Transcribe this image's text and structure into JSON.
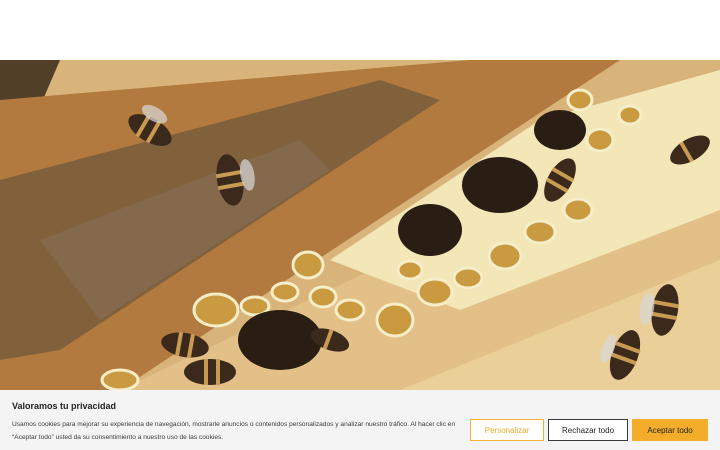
{
  "hero": {
    "image_description_icon": "beehive-photo"
  },
  "cookie_banner": {
    "title": "Valoramos tu privacidad",
    "text": "Usamos cookies para mejorar su experiencia de navegación, mostrarle anuncios o contenidos personalizados y analizar nuestro tráfico. Al hacer clic en “Aceptar todo” usted da su consentimiento a nuestro uso de las cookies.",
    "customize_label": "Personalizar",
    "reject_label": "Rechazar todo",
    "accept_label": "Aceptar todo"
  },
  "colors": {
    "accent": "#f4ad2b",
    "banner_bg": "#f4f4f4"
  }
}
